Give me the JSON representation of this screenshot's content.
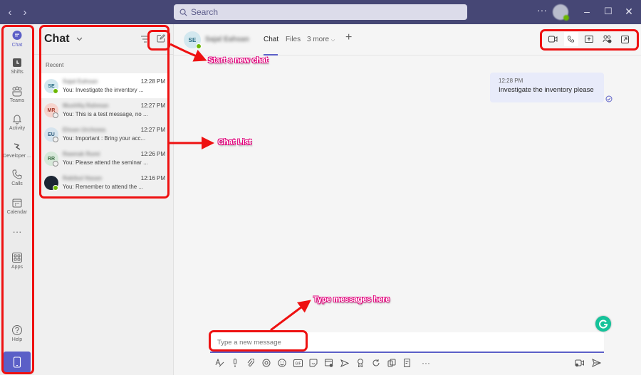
{
  "titlebar": {
    "back_icon": "chevron-left",
    "forward_icon": "chevron-right",
    "search_placeholder": "Search",
    "more_label": "···",
    "minimize": "–",
    "maximize": "☐",
    "close": "✕"
  },
  "rail": {
    "items": [
      {
        "label": "Chat",
        "icon": "chat-icon",
        "active": true
      },
      {
        "label": "Shifts",
        "icon": "shifts-icon"
      },
      {
        "label": "Teams",
        "icon": "teams-icon"
      },
      {
        "label": "Activity",
        "icon": "bell-icon"
      },
      {
        "label": "Developer ...",
        "icon": "developer-icon"
      },
      {
        "label": "Calls",
        "icon": "phone-icon"
      },
      {
        "label": "Calendar",
        "icon": "calendar-icon"
      },
      {
        "label": "···",
        "icon": "more-icon"
      },
      {
        "label": "Apps",
        "icon": "apps-icon"
      },
      {
        "label": "Help",
        "icon": "help-icon"
      }
    ],
    "mobile_icon": "mobile-icon"
  },
  "chat_list": {
    "title": "Chat",
    "section_label": "Recent",
    "items": [
      {
        "initials": "SE",
        "name": "Sajal Eahsan",
        "time": "12:28 PM",
        "preview": "You: Investigate the inventory ...",
        "status": "available",
        "selected": true,
        "avatar_bg": "#d3e8ef",
        "avatar_fg": "#286c82"
      },
      {
        "initials": "MR",
        "name": "Mushfiq Rahman",
        "time": "12:27 PM",
        "preview": "You: This is a test message, no ...",
        "status": "offline",
        "avatar_bg": "#f6d3cc",
        "avatar_fg": "#a33a2b"
      },
      {
        "initials": "EU",
        "name": "Ehsan Urchowa",
        "time": "12:27 PM",
        "preview": "You: Important : Bring your acc...",
        "status": "offline",
        "avatar_bg": "#d6e4ee",
        "avatar_fg": "#2f5c7d"
      },
      {
        "initials": "RR",
        "name": "Rawnak Rumi",
        "time": "12:26 PM",
        "preview": "You: Please attend the seminar ...",
        "status": "offline",
        "avatar_bg": "#d6e8d9",
        "avatar_fg": "#3d6e45"
      },
      {
        "initials": "",
        "name": "Rakibul Hasan",
        "time": "12:16 PM",
        "preview": "You: Remember to attend the ...",
        "status": "available",
        "avatar_bg": "#1c2634",
        "avatar_fg": "#ffffff"
      }
    ]
  },
  "conversation": {
    "initials": "SE",
    "name": "Sajal Eahsan",
    "tabs": [
      {
        "label": "Chat",
        "active": true
      },
      {
        "label": "Files"
      },
      {
        "label": "3 more"
      }
    ],
    "add_tab": "+",
    "actions": [
      "video-call",
      "audio-call",
      "share-screen",
      "add-people",
      "pop-out"
    ],
    "messages": [
      {
        "time": "12:28 PM",
        "text": "Investigate the inventory please",
        "status": "seen"
      }
    ],
    "compose_placeholder": "Type a new message"
  },
  "annotations": {
    "new_chat": "Start a new chat",
    "chat_list": "Chat List",
    "type_here": "Type messages here"
  },
  "colors": {
    "titlebar": "#464775",
    "accent": "#5b5fc7",
    "annotation_red": "#ee1111",
    "annotation_pink": "#e0007a",
    "available": "#6bb700",
    "grammarly": "#15c39a"
  }
}
